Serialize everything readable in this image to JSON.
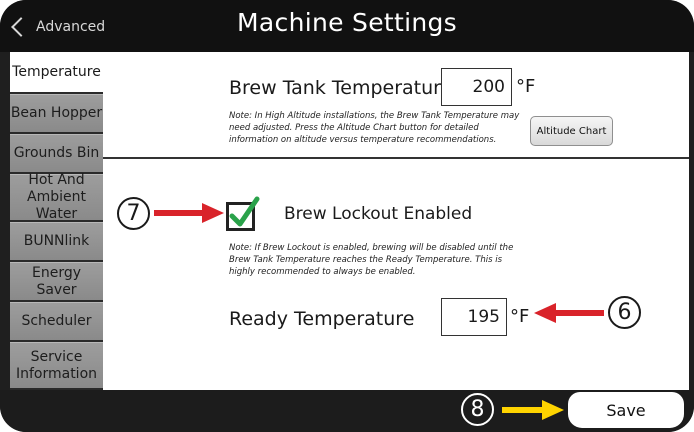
{
  "header": {
    "back_label": "Advanced",
    "title": "Machine Settings"
  },
  "sidebar": {
    "tabs": [
      {
        "label": "Temperature",
        "active": true
      },
      {
        "label": "Bean Hopper",
        "active": false
      },
      {
        "label": "Grounds Bin",
        "active": false
      },
      {
        "label": "Hot And Ambient Water",
        "active": false
      },
      {
        "label": "BUNNlink",
        "active": false
      },
      {
        "label": "Energy Saver",
        "active": false
      },
      {
        "label": "Scheduler",
        "active": false
      },
      {
        "label": "Service Information",
        "active": false
      }
    ]
  },
  "brew_tank": {
    "label": "Brew Tank Temperature",
    "value": "200",
    "unit": "°F",
    "note": "Note: In High Altitude installations, the Brew Tank Temperature may need adjusted. Press the Altitude Chart button for detailed information on altitude versus temperature recommendations.",
    "altitude_button": "Altitude Chart"
  },
  "brew_lockout": {
    "label": "Brew Lockout Enabled",
    "checked": true,
    "note": "Note: If Brew Lockout is enabled, brewing will be disabled until the Brew Tank Temperature reaches the Ready Temperature. This is highly recommended to always be enabled."
  },
  "ready_temp": {
    "label": "Ready Temperature",
    "value": "195",
    "unit": "°F"
  },
  "footer": {
    "save_label": "Save"
  },
  "callouts": {
    "six": "6",
    "seven": "7",
    "eight": "8"
  },
  "colors": {
    "arrow_red": "#d9232a",
    "arrow_yellow": "#ffd400",
    "check_green": "#2aa24a"
  }
}
